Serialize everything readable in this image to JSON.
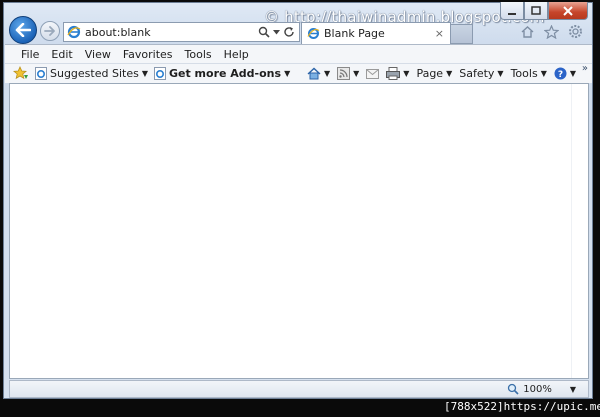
{
  "watermark": "© http://thaiwinadmin.blogspot.com",
  "address": {
    "url": "about:blank"
  },
  "tab": {
    "title": "Blank Page",
    "close": "×"
  },
  "menu": [
    "File",
    "Edit",
    "View",
    "Favorites",
    "Tools",
    "Help"
  ],
  "favorites": {
    "suggested": "Suggested Sites",
    "addons": "Get more Add-ons"
  },
  "commands": {
    "page": "Page",
    "safety": "Safety",
    "tools": "Tools"
  },
  "status": {
    "zoom": "100%"
  },
  "caption": "[788x522]https://upic.me/",
  "colors": {
    "accent": "#1b63b8",
    "close": "#c6452a"
  }
}
